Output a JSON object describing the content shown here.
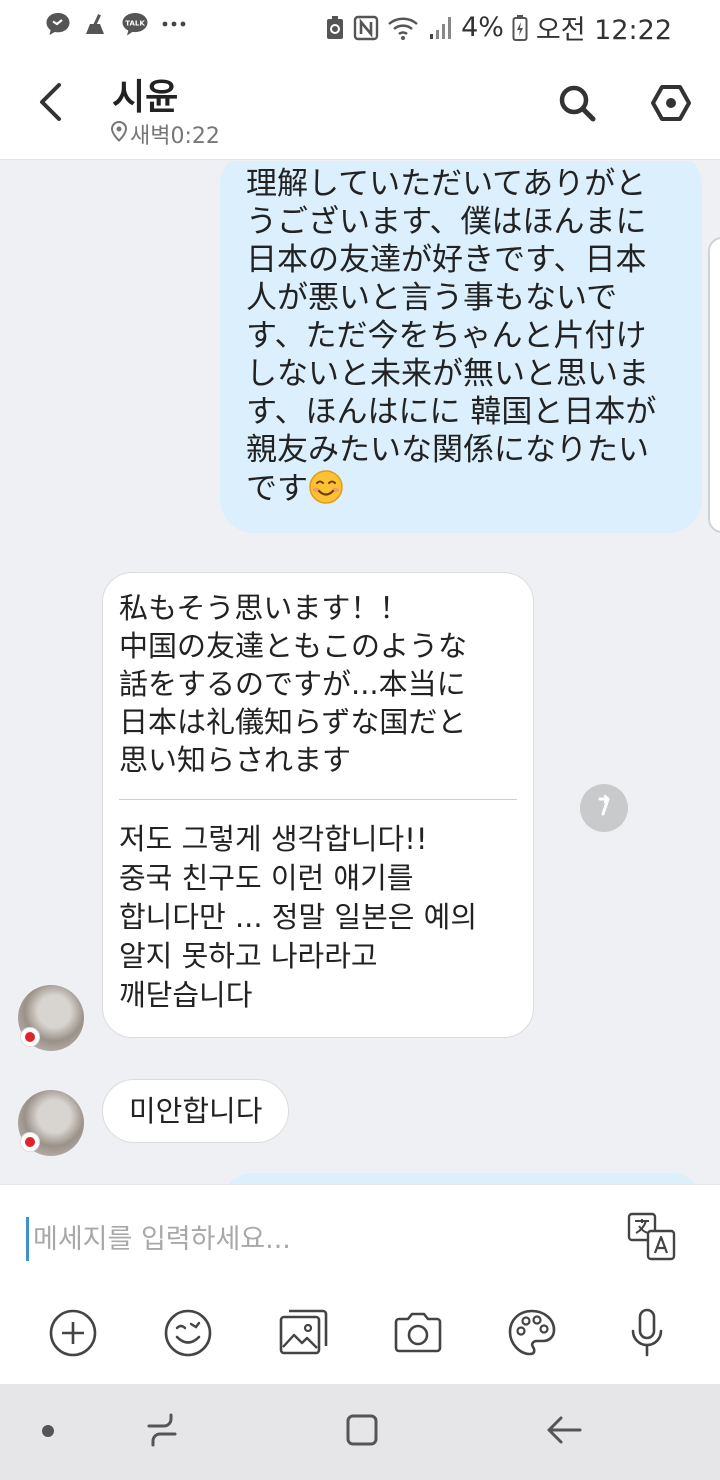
{
  "status_bar": {
    "battery_percent": "4%",
    "time": "오전 12:22",
    "icons": [
      "message-icon",
      "broom-icon",
      "kakaotalk-icon",
      "more-icon",
      "battery-saver-icon",
      "nfc-icon",
      "wifi-icon",
      "signal-icon",
      "battery-charging-icon"
    ],
    "talk_label": "TALK"
  },
  "header": {
    "title": "시윤",
    "subtitle": "새벽0:22",
    "icons": [
      "back-icon",
      "location-pin-icon",
      "search-icon",
      "settings-icon"
    ]
  },
  "messages": {
    "outgoing_1": {
      "lines": [
        "理解していただいてありがと",
        "うございます、僕はほんまに",
        "日本の友達が好きです、日本",
        "人が悪いと言う事もないで",
        "す、ただ今をちゃんと片付け",
        "しないと未来が無いと思いま",
        "す、ほんはにに 韓国と日本が",
        "親友みたいな関係になりたい",
        "です"
      ],
      "emoji": "smiling-face-icon"
    },
    "incoming_1": {
      "original_lines": [
        "私もそう思います！！",
        "中国の友達ともこのような",
        "話をするのですが...本当に",
        "日本は礼儀知らずな国だと",
        "思い知らされます"
      ],
      "translation_lines": [
        "저도 그렇게 생각합니다!!",
        "중국 친구도 이런 얘기를",
        "합니다만 ... 정말 일본은 예의",
        "알지 못하고 나라라고",
        "깨닫습니다"
      ]
    },
    "incoming_2": {
      "text": "미안합니다"
    }
  },
  "input": {
    "placeholder": "메세지를 입력하세요...",
    "value": ""
  },
  "toolbar_icons": [
    "add-icon",
    "emoji-icon",
    "gallery-icon",
    "camera-icon",
    "palette-icon",
    "microphone-icon",
    "translate-icon"
  ],
  "nav_icons": [
    "dot-icon",
    "recent-apps-icon",
    "home-icon",
    "back-nav-icon"
  ],
  "colors": {
    "outgoing_bubble": "#dbeffc",
    "incoming_bubble": "#ffffff",
    "chat_background": "#eff0f3",
    "cursor": "#3d8fd6",
    "flag_red": "#e0232a"
  }
}
